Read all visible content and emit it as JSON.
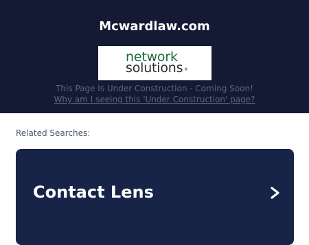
{
  "header": {
    "site_title": "Mcwardlaw.com",
    "logo": {
      "line1": "network",
      "line2": "solutions",
      "mark": "®"
    },
    "construction_text": "This Page Is Under Construction - Coming Soon!",
    "why_link": "Why am I seeing this 'Under Construction' page?"
  },
  "related": {
    "label": "Related Searches:",
    "items": [
      {
        "label": "Contact Lens",
        "icon": "chevron-right-icon"
      }
    ]
  },
  "colors": {
    "header_bg": "#141a34",
    "card_bg": "#172448",
    "logo_green": "#1d6a3b"
  }
}
